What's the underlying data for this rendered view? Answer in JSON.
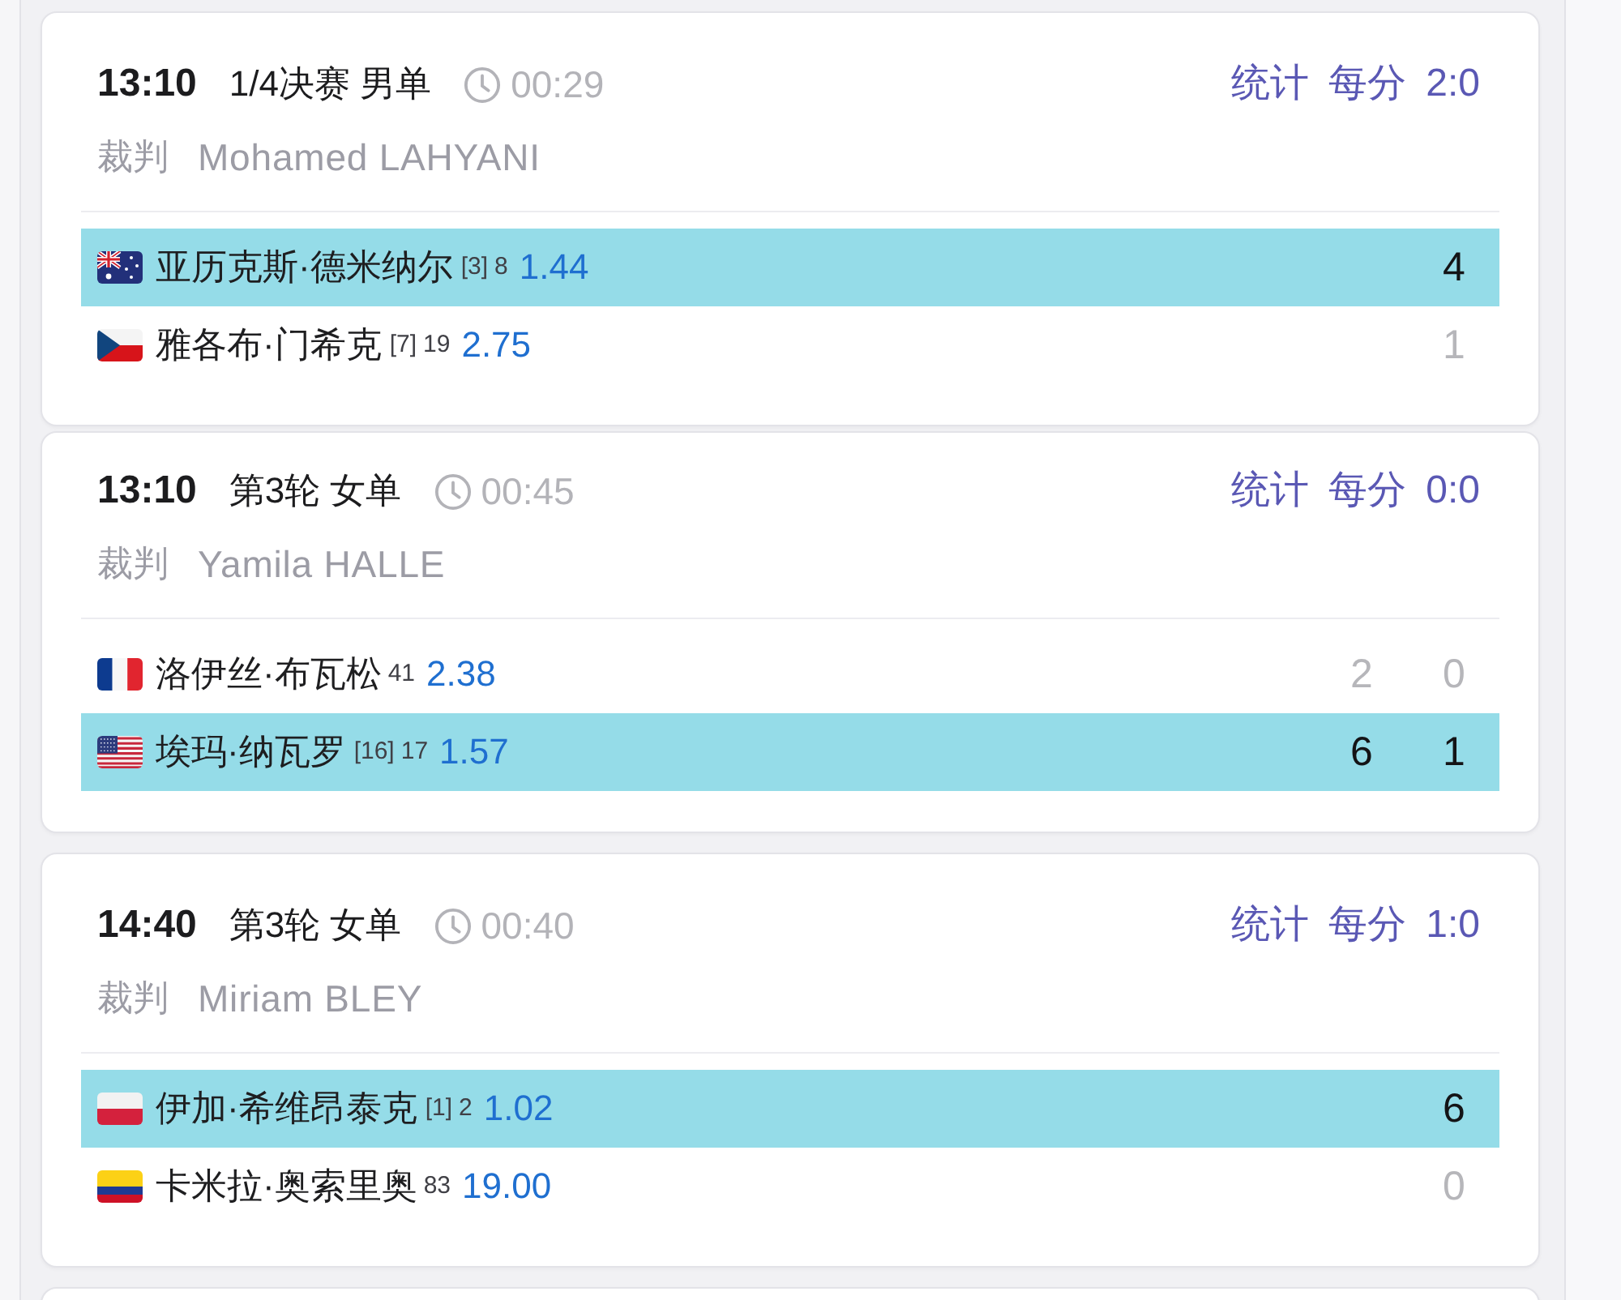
{
  "matches": [
    {
      "time": "13:10",
      "round": "1/4决赛 男单",
      "duration": "00:29",
      "stats_link": "统计",
      "points_link": "每分",
      "head_to_head": "2:0",
      "umpire_label": "裁判",
      "umpire": "Mohamed LAHYANI",
      "players": [
        {
          "kind": "australia",
          "name": "亚历克斯·德米纳尔",
          "seed": "[3]",
          "rank": "8",
          "odds": "1.44",
          "highlighted": true,
          "scores": [
            "4"
          ]
        },
        {
          "kind": "czechia",
          "name": "雅各布·门希克",
          "seed": "[7]",
          "rank": "19",
          "odds": "2.75",
          "highlighted": false,
          "scores": [
            "1"
          ]
        }
      ]
    },
    {
      "time": "13:10",
      "round": "第3轮 女单",
      "duration": "00:45",
      "stats_link": "统计",
      "points_link": "每分",
      "head_to_head": "0:0",
      "umpire_label": "裁判",
      "umpire": "Yamila HALLE",
      "players": [
        {
          "kind": "france",
          "name": "洛伊丝·布瓦松",
          "rank": "41",
          "odds": "2.38",
          "highlighted": false,
          "scores": [
            "2",
            "0"
          ]
        },
        {
          "kind": "usa",
          "name": "埃玛·纳瓦罗",
          "seed": "[16]",
          "rank": "17",
          "odds": "1.57",
          "highlighted": true,
          "scores": [
            "6",
            "1"
          ]
        }
      ]
    },
    {
      "time": "14:40",
      "round": "第3轮 女单",
      "duration": "00:40",
      "stats_link": "统计",
      "points_link": "每分",
      "head_to_head": "1:0",
      "umpire_label": "裁判",
      "umpire": "Miriam BLEY",
      "players": [
        {
          "kind": "poland",
          "name": "伊加·希维昂泰克",
          "seed": "[1]",
          "rank": "2",
          "odds": "1.02",
          "highlighted": true,
          "scores": [
            "6"
          ]
        },
        {
          "kind": "colombia",
          "name": "卡米拉·奥索里奥",
          "rank": "83",
          "odds": "19.00",
          "highlighted": false,
          "scores": [
            "0"
          ]
        }
      ]
    }
  ]
}
